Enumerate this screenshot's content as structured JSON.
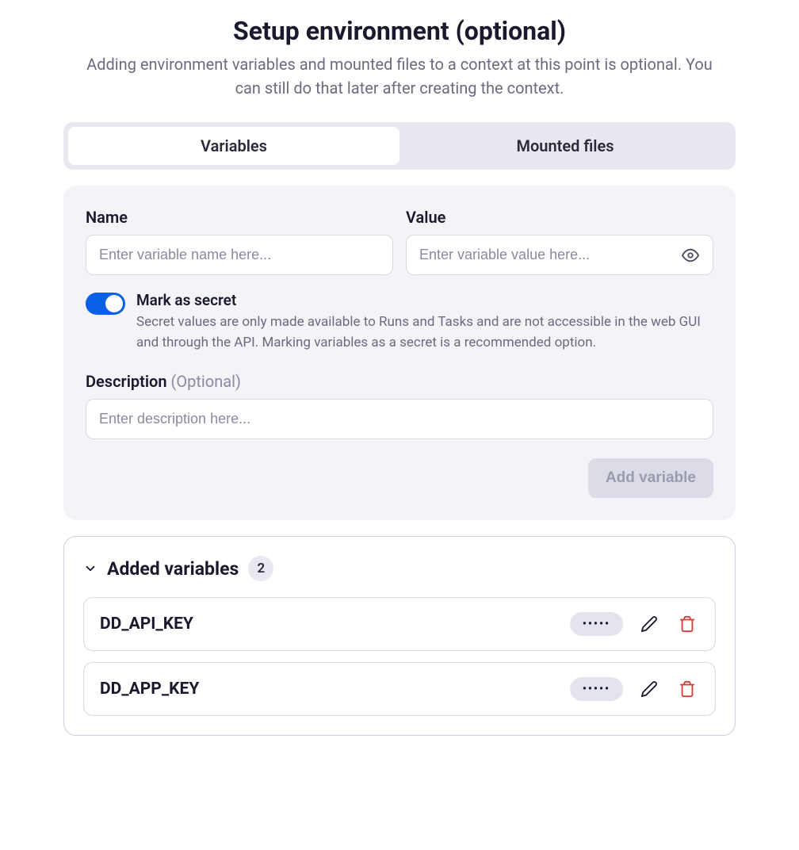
{
  "header": {
    "title": "Setup environment (optional)",
    "subtitle": "Adding environment variables and mounted files to a context at this point is optional. You can still do that later after creating the context."
  },
  "tabs": {
    "variables": "Variables",
    "mounted_files": "Mounted files"
  },
  "form": {
    "name_label": "Name",
    "name_placeholder": "Enter variable name here...",
    "value_label": "Value",
    "value_placeholder": "Enter variable value here...",
    "secret_title": "Mark as secret",
    "secret_desc": "Secret values are only made available to Runs and Tasks and are not accessible in the web GUI and through the API. Marking variables as a secret is a recommended option.",
    "description_label": "Description",
    "description_optional": "(Optional)",
    "description_placeholder": "Enter description here...",
    "add_button": "Add variable"
  },
  "added": {
    "title": "Added variables",
    "count": "2",
    "items": [
      {
        "name": "DD_API_KEY",
        "masked": "•••••"
      },
      {
        "name": "DD_APP_KEY",
        "masked": "•••••"
      }
    ]
  }
}
